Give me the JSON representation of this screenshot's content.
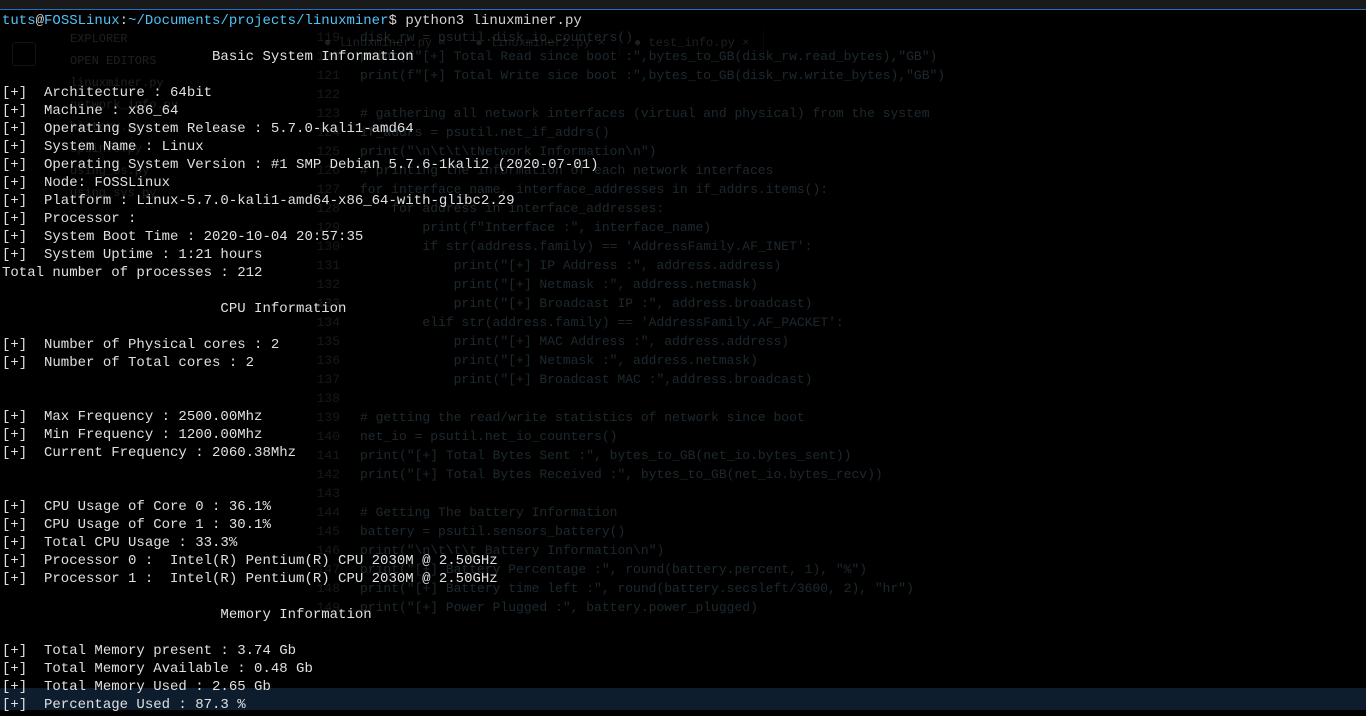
{
  "prompt": {
    "user": "tuts",
    "host": "FOSSLinux",
    "path": "~/Documents/projects/linuxminer",
    "command": "python3 linuxminer.py"
  },
  "sections": [
    {
      "header": "                         Basic System Information",
      "lines": [
        "",
        "[+]  Architecture : 64bit",
        "[+]  Machine : x86_64",
        "[+]  Operating System Release : 5.7.0-kali1-amd64",
        "[+]  System Name : Linux",
        "[+]  Operating System Version : #1 SMP Debian 5.7.6-1kali2 (2020-07-01)",
        "[+]  Node: FOSSLinux",
        "[+]  Platform : Linux-5.7.0-kali1-amd64-x86_64-with-glibc2.29",
        "[+]  Processor :",
        "[+]  System Boot Time : 2020-10-04 20:57:35",
        "[+]  System Uptime : 1:21 hours",
        "Total number of processes : 212",
        ""
      ]
    },
    {
      "header": "                          CPU Information",
      "lines": [
        "",
        "[+]  Number of Physical cores : 2",
        "[+]  Number of Total cores : 2",
        "",
        "",
        "[+]  Max Frequency : 2500.00Mhz",
        "[+]  Min Frequency : 1200.00Mhz",
        "[+]  Current Frequency : 2060.38Mhz",
        "",
        "",
        "[+]  CPU Usage of Core 0 : 36.1%",
        "[+]  CPU Usage of Core 1 : 30.1%",
        "[+]  Total CPU Usage : 33.3%",
        "[+]  Processor 0 :  Intel(R) Pentium(R) CPU 2030M @ 2.50GHz",
        "[+]  Processor 1 :  Intel(R) Pentium(R) CPU 2030M @ 2.50GHz",
        ""
      ]
    },
    {
      "header": "                          Memory Information",
      "lines": [
        "",
        "[+]  Total Memory present : 3.74 Gb",
        "[+]  Total Memory Available : 0.48 Gb",
        "[+]  Total Memory Used : 2.65 Gb",
        "[+]  Percentage Used : 87.3 %"
      ]
    }
  ],
  "bg": {
    "tabs": [
      "linuxminer.py",
      "linuxminer2.py",
      "test_info.py"
    ],
    "code": [
      {
        "ln": "119",
        "txt": "disk_rw = psutil.disk_io_counters()"
      },
      {
        "ln": "120",
        "txt": "print(f\"[+] Total Read since boot :\",bytes_to_GB(disk_rw.read_bytes),\"GB\")"
      },
      {
        "ln": "121",
        "txt": "print(f\"[+] Total Write sice boot :\",bytes_to_GB(disk_rw.write_bytes),\"GB\")"
      },
      {
        "ln": "122",
        "txt": ""
      },
      {
        "ln": "123",
        "txt": "# gathering all network interfaces (virtual and physical) from the system"
      },
      {
        "ln": "124",
        "txt": "if_addrs = psutil.net_if_addrs()"
      },
      {
        "ln": "125",
        "txt": "print(\"\\n\\t\\t\\tNetwork Information\\n\")"
      },
      {
        "ln": "126",
        "txt": "# printing the information of each network interfaces"
      },
      {
        "ln": "127",
        "txt": "for interface_name, interface_addresses in if_addrs.items():"
      },
      {
        "ln": "128",
        "txt": "    for address in interface_addresses:"
      },
      {
        "ln": "129",
        "txt": "        print(f\"Interface :\", interface_name)"
      },
      {
        "ln": "130",
        "txt": "        if str(address.family) == 'AddressFamily.AF_INET':"
      },
      {
        "ln": "131",
        "txt": "            print(\"[+] IP Address :\", address.address)"
      },
      {
        "ln": "132",
        "txt": "            print(\"[+] Netmask :\", address.netmask)"
      },
      {
        "ln": "133",
        "txt": "            print(\"[+] Broadcast IP :\", address.broadcast)"
      },
      {
        "ln": "134",
        "txt": "        elif str(address.family) == 'AddressFamily.AF_PACKET':"
      },
      {
        "ln": "135",
        "txt": "            print(\"[+] MAC Address :\", address.address)"
      },
      {
        "ln": "136",
        "txt": "            print(\"[+] Netmask :\", address.netmask)"
      },
      {
        "ln": "137",
        "txt": "            print(\"[+] Broadcast MAC :\",address.broadcast)"
      },
      {
        "ln": "138",
        "txt": ""
      },
      {
        "ln": "139",
        "txt": "# getting the read/write statistics of network since boot"
      },
      {
        "ln": "140",
        "txt": "net_io = psutil.net_io_counters()"
      },
      {
        "ln": "141",
        "txt": "print(\"[+] Total Bytes Sent :\", bytes_to_GB(net_io.bytes_sent))"
      },
      {
        "ln": "142",
        "txt": "print(\"[+] Total Bytes Received :\", bytes_to_GB(net_io.bytes_recv))"
      },
      {
        "ln": "143",
        "txt": ""
      },
      {
        "ln": "144",
        "txt": "# Getting The battery Information"
      },
      {
        "ln": "145",
        "txt": "battery = psutil.sensors_battery()"
      },
      {
        "ln": "146",
        "txt": "print(\"\\n\\t\\t\\t Battery Information\\n\")"
      },
      {
        "ln": "147",
        "txt": "print(\"[+] Battery Percentage :\", round(battery.percent, 1), \"%\")"
      },
      {
        "ln": "148",
        "txt": "print(\"[+] Battery time left :\", round(battery.secsleft/3600, 2), \"hr\")"
      },
      {
        "ln": "149",
        "txt": "print(\"[+] Power Plugged :\", battery.power_plugged)"
      }
    ],
    "sidebar": [
      "EXPLORER",
      "OPEN EDITORS",
      "linuxminer.py",
      "network_info.py",
      "history.py",
      "cpuinfo.py",
      "using_os.py",
      "using_sys.py"
    ]
  }
}
